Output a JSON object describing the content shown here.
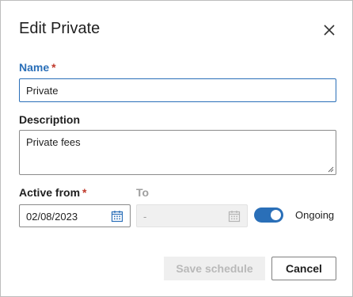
{
  "dialog": {
    "title": "Edit Private"
  },
  "form": {
    "name_label": "Name",
    "name_required": "*",
    "name_value": "Private",
    "description_label": "Description",
    "description_value": "Private fees",
    "active_from_label": "Active from",
    "active_from_required": "*",
    "active_from_value": "02/08/2023",
    "to_label": "To",
    "to_value": "-",
    "ongoing_label": "Ongoing",
    "ongoing_enabled": true
  },
  "buttons": {
    "save_label": "Save schedule",
    "cancel_label": "Cancel"
  },
  "colors": {
    "accent": "#2a6fb8",
    "required": "#c0392b",
    "disabled_text": "#b9b9b9",
    "disabled_bg": "#efefef"
  },
  "icons": {
    "close": "close-icon",
    "calendar": "calendar-icon",
    "resize": "resize-handle-icon"
  }
}
